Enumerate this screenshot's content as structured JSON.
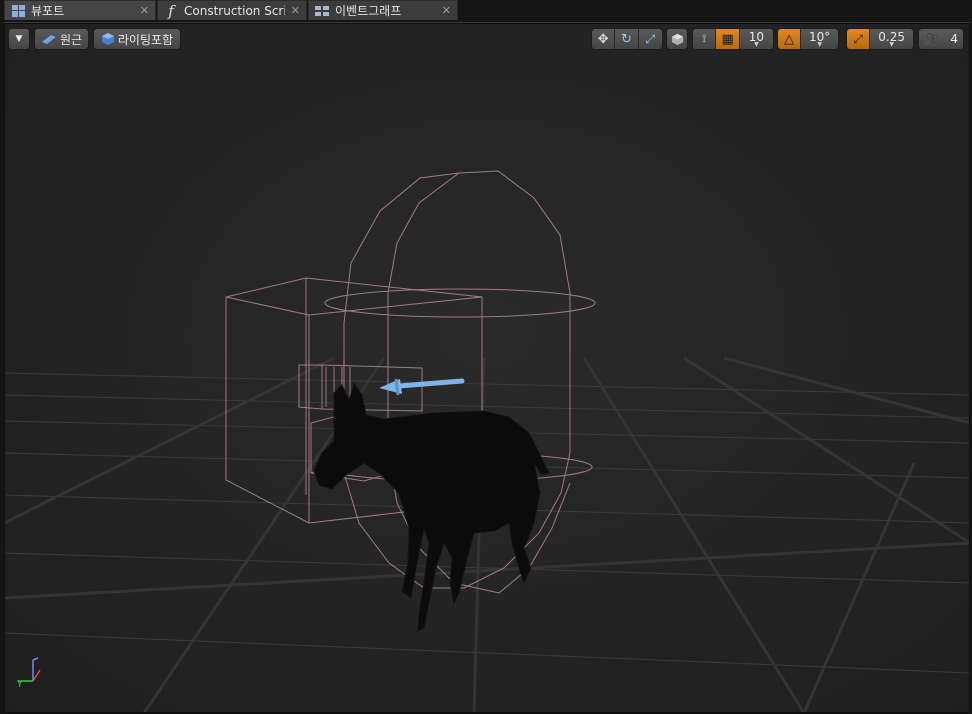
{
  "tabs": [
    {
      "label": "뷰포트",
      "icon": "viewport-grid-icon",
      "close": "✕"
    },
    {
      "label": "Construction Scrip",
      "icon": "function-icon",
      "close": "✕"
    },
    {
      "label": "이벤트그래프",
      "icon": "event-graph-icon",
      "close": "✕"
    }
  ],
  "toolbar": {
    "perspective_label": "원근",
    "lighting_label": "라이팅포함",
    "grid_snap_value": "10",
    "rotation_snap_value": "10°",
    "scale_snap_value": "0.25",
    "camera_speed_value": "4"
  },
  "colors": {
    "accent_orange": "#e18a1d",
    "collision_wire": "#b88a93",
    "arrow_blue": "#7fb4e8",
    "viewport_bg": "#262626",
    "axis_green": "#36c936"
  }
}
